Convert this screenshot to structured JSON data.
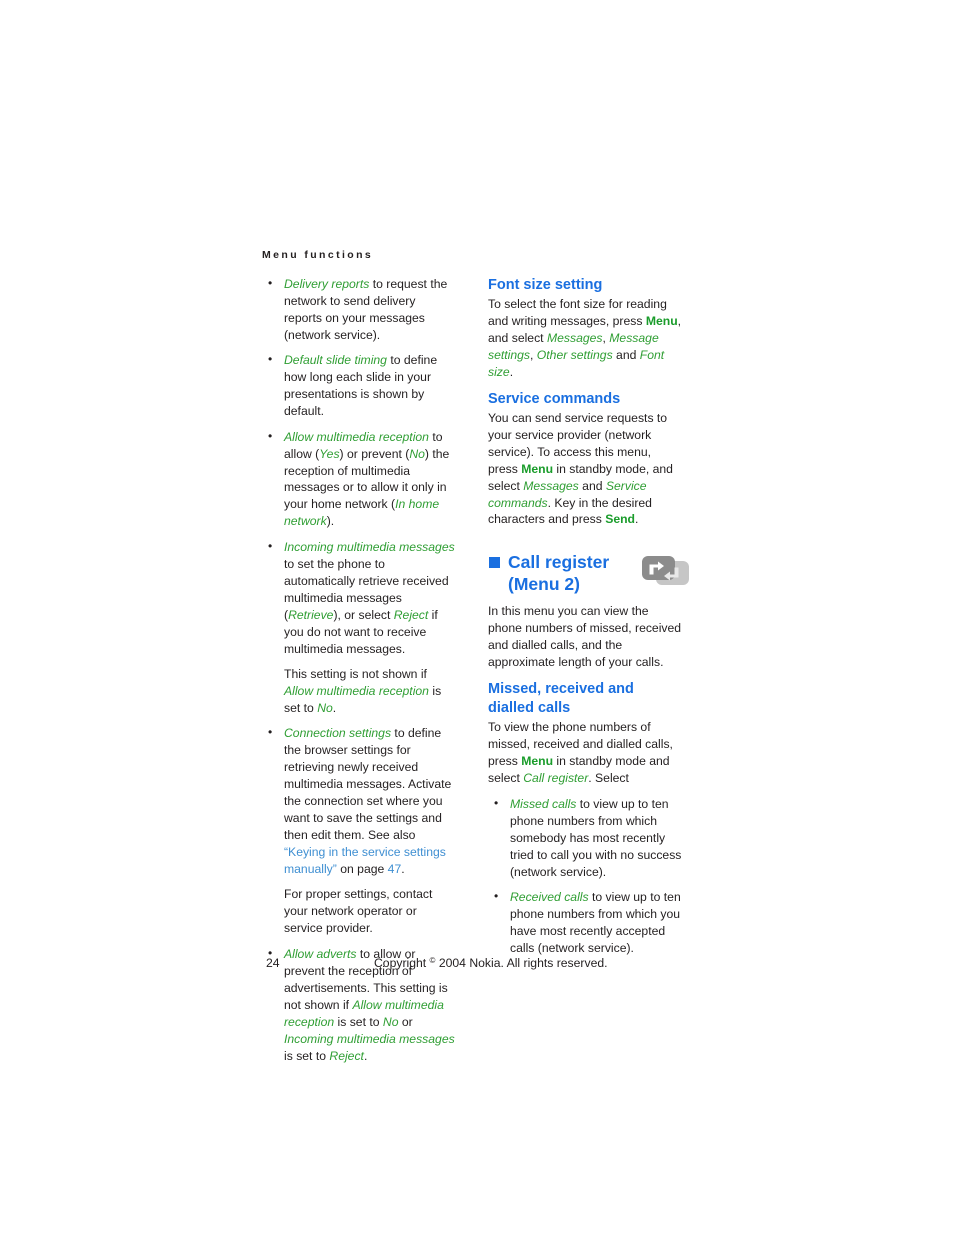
{
  "page": {
    "running_head": "Menu functions",
    "folio": "24",
    "copyright_pre": "Copyright ",
    "copyright_mark": "©",
    "copyright_post": " 2004 Nokia. All rights reserved."
  },
  "colors": {
    "heading_blue": "#1a6fe0",
    "link_blue": "#3f8fd2",
    "ui_term_green": "#2f9e33",
    "hard_key_green": "#1a9c2b",
    "body_text": "#231f20",
    "icon_dark_gray": "#8a8a8a",
    "icon_light_gray": "#c3c3c3"
  },
  "left_column": {
    "bullets": [
      {
        "id": "delivery-reports",
        "parts": [
          {
            "t": "Delivery reports",
            "s": "gi"
          },
          {
            "t": " to request the network to send delivery reports on your messages (network service).",
            "s": ""
          }
        ]
      },
      {
        "id": "default-slide-timing",
        "parts": [
          {
            "t": "Default slide timing",
            "s": "gi"
          },
          {
            "t": " to define how long each slide in your presentations is shown by default.",
            "s": ""
          }
        ]
      },
      {
        "id": "allow-multimedia-reception",
        "parts": [
          {
            "t": "Allow multimedia reception",
            "s": "gi"
          },
          {
            "t": " to allow (",
            "s": ""
          },
          {
            "t": "Yes",
            "s": "gi"
          },
          {
            "t": ") or prevent (",
            "s": ""
          },
          {
            "t": "No",
            "s": "gi"
          },
          {
            "t": ") the reception of multimedia messages or to allow it only in your home network (",
            "s": ""
          },
          {
            "t": "In home network",
            "s": "gi"
          },
          {
            "t": ").",
            "s": ""
          }
        ]
      },
      {
        "id": "incoming-multimedia-messages",
        "parts": [
          {
            "t": "Incoming multimedia messages",
            "s": "gi"
          },
          {
            "t": " to set the phone to automatically retrieve received multimedia messages (",
            "s": ""
          },
          {
            "t": "Retrieve",
            "s": "gi"
          },
          {
            "t": "), or select ",
            "s": ""
          },
          {
            "t": "Reject",
            "s": "gi"
          },
          {
            "t": " if you do not want to receive multimedia messages.",
            "s": ""
          }
        ],
        "sub": [
          {
            "t": "This setting is not shown if ",
            "s": ""
          },
          {
            "t": "Allow multimedia reception",
            "s": "gi"
          },
          {
            "t": " is set to ",
            "s": ""
          },
          {
            "t": "No",
            "s": "gi"
          },
          {
            "t": ".",
            "s": ""
          }
        ]
      },
      {
        "id": "connection-settings",
        "parts": [
          {
            "t": "Connection settings",
            "s": "gi"
          },
          {
            "t": " to define the browser settings for retrieving newly received multimedia messages. Activate the connection set where you want to save the settings and then edit them. See also ",
            "s": ""
          },
          {
            "t": "“Keying in the service settings manually”",
            "s": "lnk"
          },
          {
            "t": " on page ",
            "s": ""
          },
          {
            "t": "47",
            "s": "lnk"
          },
          {
            "t": ".",
            "s": ""
          }
        ],
        "sub": [
          {
            "t": "For proper settings, contact your network operator or service provider.",
            "s": ""
          }
        ]
      },
      {
        "id": "allow-adverts",
        "parts": [
          {
            "t": "Allow adverts",
            "s": "gi"
          },
          {
            "t": " to allow or prevent the reception of advertisements. This setting is not shown if ",
            "s": ""
          },
          {
            "t": "Allow multimedia reception",
            "s": "gi"
          },
          {
            "t": " is set to ",
            "s": ""
          },
          {
            "t": "No",
            "s": "gi"
          },
          {
            "t": " or ",
            "s": ""
          },
          {
            "t": "Incoming multimedia messages",
            "s": "gi"
          },
          {
            "t": " is set to ",
            "s": ""
          },
          {
            "t": "Reject",
            "s": "gi"
          },
          {
            "t": ".",
            "s": ""
          }
        ]
      }
    ]
  },
  "right_column": {
    "font_size_setting": {
      "heading": "Font size setting",
      "body": [
        {
          "t": "To select the font size for reading and writing messages, press ",
          "s": ""
        },
        {
          "t": "Menu",
          "s": "gb"
        },
        {
          "t": ", and select ",
          "s": ""
        },
        {
          "t": "Messages",
          "s": "gi"
        },
        {
          "t": ", ",
          "s": ""
        },
        {
          "t": "Message settings",
          "s": "gi"
        },
        {
          "t": ", ",
          "s": ""
        },
        {
          "t": "Other settings",
          "s": "gi"
        },
        {
          "t": " and ",
          "s": ""
        },
        {
          "t": "Font size",
          "s": "gi"
        },
        {
          "t": ".",
          "s": ""
        }
      ]
    },
    "service_commands": {
      "heading": "Service commands",
      "body": [
        {
          "t": "You can send service requests to your service provider (network service). To access this menu, press ",
          "s": ""
        },
        {
          "t": "Menu",
          "s": "gb"
        },
        {
          "t": " in standby mode, and select ",
          "s": ""
        },
        {
          "t": "Messages",
          "s": "gi"
        },
        {
          "t": " and ",
          "s": ""
        },
        {
          "t": "Service commands",
          "s": "gi"
        },
        {
          "t": ". Key in the desired characters and press ",
          "s": ""
        },
        {
          "t": "Send",
          "s": "gb"
        },
        {
          "t": ".",
          "s": ""
        }
      ]
    },
    "call_register": {
      "title_line1": "Call register",
      "title_line2": "(Menu 2)",
      "icon_name": "call-register-icon",
      "body": [
        {
          "t": "In this menu you can view the phone numbers of missed, received and dialled calls, and the approximate length of your calls.",
          "s": ""
        }
      ]
    },
    "missed_received_dialled": {
      "heading": "Missed, received and dialled calls",
      "intro": [
        {
          "t": "To view the phone numbers of missed, received and dialled calls, press ",
          "s": ""
        },
        {
          "t": "Menu",
          "s": "gb"
        },
        {
          "t": " in standby mode and select ",
          "s": ""
        },
        {
          "t": "Call register",
          "s": "gi"
        },
        {
          "t": ". Select",
          "s": ""
        }
      ],
      "bullets": [
        {
          "id": "missed-calls",
          "parts": [
            {
              "t": "Missed calls",
              "s": "gi"
            },
            {
              "t": " to view up to ten phone numbers from which somebody has most recently tried to call you with no success (network service).",
              "s": ""
            }
          ]
        },
        {
          "id": "received-calls",
          "parts": [
            {
              "t": "Received calls",
              "s": "gi"
            },
            {
              "t": " to view up to ten phone numbers from which you have most recently accepted calls (network service).",
              "s": ""
            }
          ]
        }
      ]
    }
  }
}
